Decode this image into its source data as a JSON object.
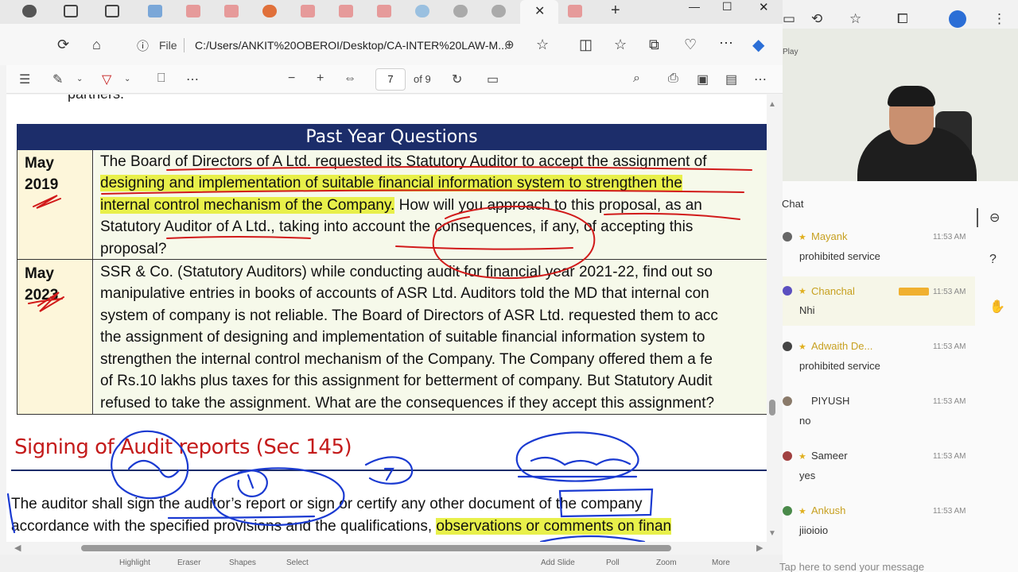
{
  "browser": {
    "tab_close": "✕",
    "new_tab": "+",
    "win_min": "—",
    "win_max": "☐",
    "win_close": "✕",
    "file_label": "File",
    "url": "C:/Users/ANKIT%20OBEROI/Desktop/CA-INTER%20LAW-M..."
  },
  "pdf_toolbar": {
    "page_current": "7",
    "page_total": "of 9"
  },
  "document": {
    "partners": "partners.",
    "pyq_title": "Past Year Questions",
    "q1": {
      "year_month": "May",
      "year": "2019",
      "lines": [
        "The Board of Directors of A Ltd. requested its Statutory Auditor to accept the assignment of",
        "designing and implementation of suitable financial information system to strengthen the",
        "internal control mechanism of the Company.",
        " How will you approach to this proposal, as an",
        "Statutory Auditor of A Ltd., taking into account the consequences, if any, of accepting this",
        "proposal?"
      ]
    },
    "q2": {
      "year_month": "May",
      "year": "2023",
      "lines": [
        "SSR & Co. (Statutory Auditors) while conducting audit for financial year 2021-22, find out so",
        "manipulative entries in books of accounts of ASR Ltd. Auditors told the MD that internal con",
        "system of company is not reliable. The Board of Directors of ASR Ltd. requested them to acc",
        "the assignment of designing and implementation of suitable financial information system to",
        "strengthen the internal control mechanism of the Company. The Company offered them a fe",
        "of Rs.10 lakhs plus taxes for this assignment for betterment of company. But Statutory Audit",
        "refused to take the assignment. What are the consequences if they accept this assignment?"
      ]
    },
    "section_title": "Signing of Audit reports (Sec 145)",
    "body": [
      "The auditor shall sign the auditor’s report or sign or certify any other document of the company",
      "accordance with the specified provisions and the qualifications, ",
      "observations or comments on finan"
    ]
  },
  "meeting_controls": [
    "Highlight",
    "Eraser",
    "Shapes",
    "Select",
    "Add Slide",
    "Poll",
    "Zoom",
    "More"
  ],
  "side_panel": {
    "video_label": "Play",
    "chat_title": "Chat",
    "messages": [
      {
        "name": "Mayank",
        "time": "11:53 AM",
        "text": "prohibited service",
        "name_color": "#c7a020",
        "avatar_color": "#666666"
      },
      {
        "name": "Chanchal",
        "time": "11:53 AM",
        "text": "Nhi",
        "name_color": "#c7a020",
        "avatar_color": "#5b4fc0"
      },
      {
        "name": "Adwaith De...",
        "time": "11:53 AM",
        "text": "prohibited service",
        "name_color": "#c7a020",
        "avatar_color": "#444444"
      },
      {
        "name": "PIYUSH",
        "time": "11:53 AM",
        "text": "no",
        "name_color": "#333333",
        "avatar_color": "#8a7a6a"
      },
      {
        "name": "Sameer",
        "time": "11:53 AM",
        "text": "yes",
        "name_color": "#333333",
        "avatar_color": "#a04040"
      },
      {
        "name": "Ankush",
        "time": "11:53 AM",
        "text": "jiioioio",
        "name_color": "#c7a020",
        "avatar_color": "#4a8a4a"
      }
    ],
    "chat_placeholder": "Tap here to send your message"
  },
  "colors": {
    "pyq_header": "#1c2d6a",
    "highlight": "#e8f04a",
    "annotation_red": "#d11a1a",
    "annotation_blue": "#1a3ad1",
    "section_title": "#c41b1b"
  }
}
